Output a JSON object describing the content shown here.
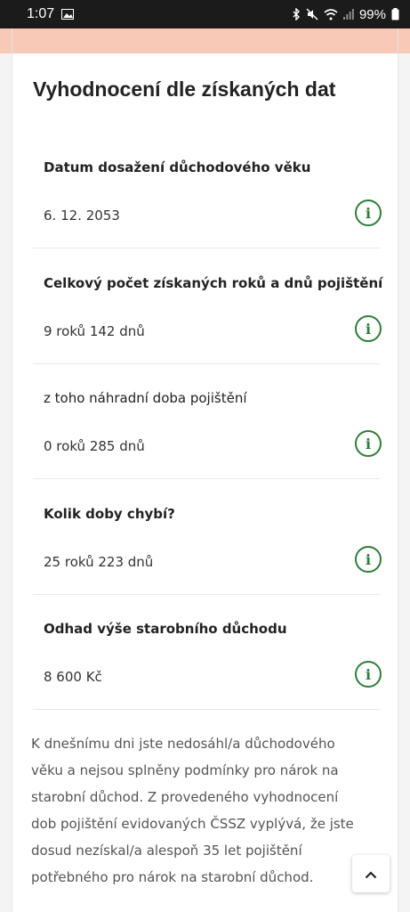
{
  "status_bar": {
    "time": "1:07",
    "battery": "99%"
  },
  "section": {
    "title": "Vyhodnocení dle získaných dat"
  },
  "items": [
    {
      "label": "Datum dosažení důchodového věku",
      "value": "6. 12. 2053",
      "bold": true
    },
    {
      "label": "Celkový počet získaných roků a dnů pojištění",
      "value": "9 roků 142 dnů",
      "bold": true
    },
    {
      "label": "z toho náhradní doba pojištění",
      "value": "0 roků 285 dnů",
      "bold": false
    },
    {
      "label": "Kolik doby chybí?",
      "value": "25 roků 223 dnů",
      "bold": true
    },
    {
      "label": "Odhad výše starobního důchodu",
      "value": "8 600 Kč",
      "bold": true
    }
  ],
  "info_icon": "info-circle-icon",
  "note": "K dnešnímu dni jste nedosáhl/a důchodového věku a nejsou splněny podmínky pro nárok na starobní důchod. Z provedeného vyhodnocení dob pojištění evidovaných ČSSZ vyplývá, že jste dosud nezískal/a alespoň 35 let pojištění potřebného pro nárok na starobní důchod.",
  "colors": {
    "accent_green": "#2e7d3a",
    "banner_pink": "#f9c9b8"
  }
}
